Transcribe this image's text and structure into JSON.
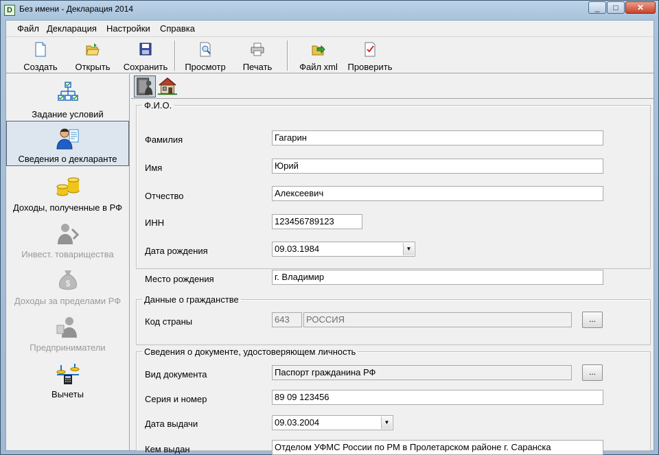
{
  "window": {
    "title": "Без имени - Декларация 2014",
    "icon_letter": "D",
    "minimize": "_",
    "maximize": "□",
    "close": "✕"
  },
  "menu": [
    "Файл",
    "Декларация",
    "Настройки",
    "Справка"
  ],
  "toolbar": {
    "create": "Создать",
    "open": "Открыть",
    "save": "Сохранить",
    "preview": "Просмотр",
    "print": "Печать",
    "xml": "Файл xml",
    "check": "Проверить"
  },
  "sidebar": {
    "items": [
      {
        "label": "Задание условий",
        "icon": "conditions-icon",
        "state": "normal"
      },
      {
        "label": "Сведения о декларанте",
        "icon": "declarant-icon",
        "state": "active"
      },
      {
        "label": "Доходы, полученные в РФ",
        "icon": "coins-icon",
        "state": "normal"
      },
      {
        "label": "Инвест. товарищества",
        "icon": "investment-icon",
        "state": "disabled"
      },
      {
        "label": "Доходы за пределами РФ",
        "icon": "moneybag-icon",
        "state": "disabled"
      },
      {
        "label": "Предприниматели",
        "icon": "entrepreneur-icon",
        "state": "disabled"
      },
      {
        "label": "Вычеты",
        "icon": "deductions-icon",
        "state": "normal"
      }
    ]
  },
  "tabs": {
    "person_icon": "person-door-icon",
    "house_icon": "house-icon"
  },
  "fio": {
    "title": "Ф.И.О.",
    "surname_label": "Фамилия",
    "surname": "Гагарин",
    "name_label": "Имя",
    "name": "Юрий",
    "patronymic_label": "Отчество",
    "patronymic": "Алексеевич",
    "inn_label": "ИНН",
    "inn": "123456789123",
    "birthdate_label": "Дата рождения",
    "birthdate": "09.03.1984",
    "birthplace_label": "Место рождения",
    "birthplace": "г. Владимир"
  },
  "citizenship": {
    "title": "Данные о гражданстве",
    "country_label": "Код страны",
    "country_code": "643",
    "country_name": "РОССИЯ",
    "browse": "..."
  },
  "document": {
    "title": "Сведения о документе, удостоверяющем личность",
    "type_label": "Вид документа",
    "type": "Паспорт гражданина РФ",
    "browse": "...",
    "series_label": "Серия и номер",
    "series": "89 09 123456",
    "issue_date_label": "Дата выдачи",
    "issue_date": "09.03.2004",
    "issued_by_label": "Кем выдан",
    "issued_by": "Отделом УФМС России по РМ в Пролетарском районе г. Саранска"
  }
}
